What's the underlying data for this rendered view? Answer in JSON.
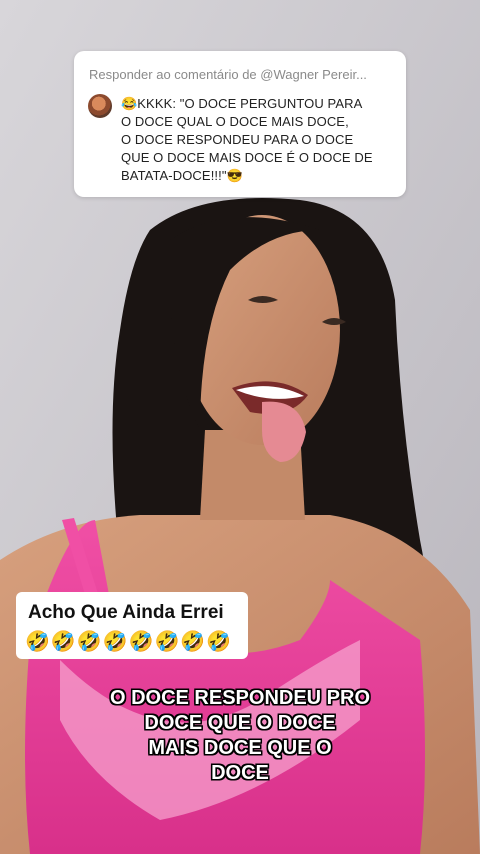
{
  "reply_card": {
    "header": "Responder ao comentário de @Wagner Pereir...",
    "comment_lines": [
      "😂KKKK: \"O DOCE PERGUNTOU PARA",
      "O DOCE QUAL O DOCE MAIS DOCE,",
      "O DOCE RESPONDEU PARA O DOCE",
      "QUE O DOCE MAIS DOCE É O DOCE DE",
      "BATATA-DOCE!!!\"😎"
    ]
  },
  "sticker": {
    "title": "Acho Que Ainda Errei",
    "emojis": "🤣🤣🤣🤣🤣🤣🤣🤣"
  },
  "caption": {
    "lines": [
      "O DOCE RESPONDEU PRO",
      "DOCE QUE O DOCE",
      "MAIS DOCE QUE O",
      "DOCE"
    ]
  },
  "colors": {
    "background_wall": "#c9c6cc",
    "dress": "#e8409a",
    "hair": "#1a1412",
    "skin": "#c98f6f"
  }
}
